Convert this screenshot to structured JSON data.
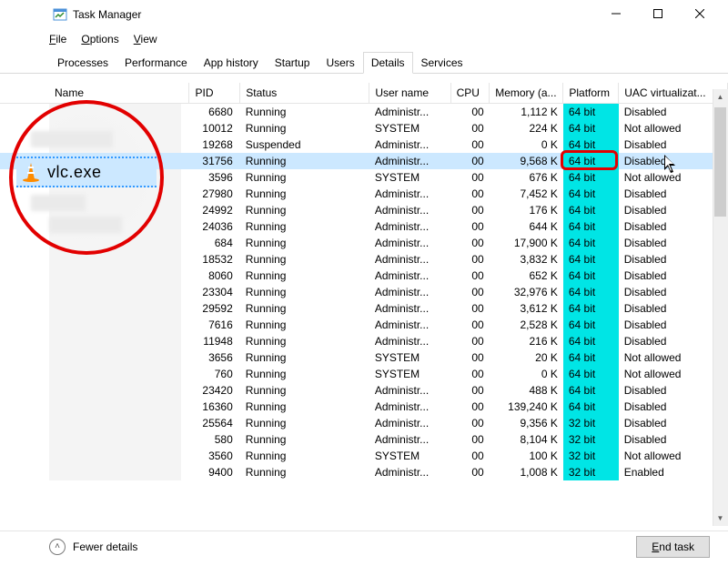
{
  "window": {
    "title": "Task Manager"
  },
  "menu": {
    "file": "File",
    "options": "Options",
    "view": "View"
  },
  "tabs": {
    "processes": "Processes",
    "performance": "Performance",
    "app_history": "App history",
    "startup": "Startup",
    "users": "Users",
    "details": "Details",
    "services": "Services",
    "active": "Details"
  },
  "columns": {
    "name": "Name",
    "pid": "PID",
    "status": "Status",
    "user": "User name",
    "cpu": "CPU",
    "memory": "Memory (a...",
    "platform": "Platform",
    "uac": "UAC virtualizat..."
  },
  "rows": [
    {
      "pid": "6680",
      "status": "Running",
      "user": "Administr...",
      "cpu": "00",
      "mem": "1,112 K",
      "plat": "64 bit",
      "uac": "Disabled"
    },
    {
      "pid": "10012",
      "status": "Running",
      "user": "SYSTEM",
      "cpu": "00",
      "mem": "224 K",
      "plat": "64 bit",
      "uac": "Not allowed"
    },
    {
      "pid": "19268",
      "status": "Suspended",
      "user": "Administr...",
      "cpu": "00",
      "mem": "0 K",
      "plat": "64 bit",
      "uac": "Disabled"
    },
    {
      "pid": "31756",
      "status": "Running",
      "user": "Administr...",
      "cpu": "00",
      "mem": "9,568 K",
      "plat": "64 bit",
      "uac": "Disabled",
      "selected": true,
      "name": "vlc.exe"
    },
    {
      "pid": "3596",
      "status": "Running",
      "user": "SYSTEM",
      "cpu": "00",
      "mem": "676 K",
      "plat": "64 bit",
      "uac": "Not allowed"
    },
    {
      "pid": "27980",
      "status": "Running",
      "user": "Administr...",
      "cpu": "00",
      "mem": "7,452 K",
      "plat": "64 bit",
      "uac": "Disabled"
    },
    {
      "pid": "24992",
      "status": "Running",
      "user": "Administr...",
      "cpu": "00",
      "mem": "176 K",
      "plat": "64 bit",
      "uac": "Disabled"
    },
    {
      "pid": "24036",
      "status": "Running",
      "user": "Administr...",
      "cpu": "00",
      "mem": "644 K",
      "plat": "64 bit",
      "uac": "Disabled"
    },
    {
      "pid": "684",
      "status": "Running",
      "user": "Administr...",
      "cpu": "00",
      "mem": "17,900 K",
      "plat": "64 bit",
      "uac": "Disabled"
    },
    {
      "pid": "18532",
      "status": "Running",
      "user": "Administr...",
      "cpu": "00",
      "mem": "3,832 K",
      "plat": "64 bit",
      "uac": "Disabled"
    },
    {
      "pid": "8060",
      "status": "Running",
      "user": "Administr...",
      "cpu": "00",
      "mem": "652 K",
      "plat": "64 bit",
      "uac": "Disabled"
    },
    {
      "pid": "23304",
      "status": "Running",
      "user": "Administr...",
      "cpu": "00",
      "mem": "32,976 K",
      "plat": "64 bit",
      "uac": "Disabled"
    },
    {
      "pid": "29592",
      "status": "Running",
      "user": "Administr...",
      "cpu": "00",
      "mem": "3,612 K",
      "plat": "64 bit",
      "uac": "Disabled"
    },
    {
      "pid": "7616",
      "status": "Running",
      "user": "Administr...",
      "cpu": "00",
      "mem": "2,528 K",
      "plat": "64 bit",
      "uac": "Disabled"
    },
    {
      "pid": "11948",
      "status": "Running",
      "user": "Administr...",
      "cpu": "00",
      "mem": "216 K",
      "plat": "64 bit",
      "uac": "Disabled"
    },
    {
      "pid": "3656",
      "status": "Running",
      "user": "SYSTEM",
      "cpu": "00",
      "mem": "20 K",
      "plat": "64 bit",
      "uac": "Not allowed"
    },
    {
      "pid": "760",
      "status": "Running",
      "user": "SYSTEM",
      "cpu": "00",
      "mem": "0 K",
      "plat": "64 bit",
      "uac": "Not allowed"
    },
    {
      "pid": "23420",
      "status": "Running",
      "user": "Administr...",
      "cpu": "00",
      "mem": "488 K",
      "plat": "64 bit",
      "uac": "Disabled"
    },
    {
      "pid": "16360",
      "status": "Running",
      "user": "Administr...",
      "cpu": "00",
      "mem": "139,240 K",
      "plat": "64 bit",
      "uac": "Disabled"
    },
    {
      "pid": "25564",
      "status": "Running",
      "user": "Administr...",
      "cpu": "00",
      "mem": "9,356 K",
      "plat": "32 bit",
      "uac": "Disabled"
    },
    {
      "pid": "580",
      "status": "Running",
      "user": "Administr...",
      "cpu": "00",
      "mem": "8,104 K",
      "plat": "32 bit",
      "uac": "Disabled"
    },
    {
      "pid": "3560",
      "status": "Running",
      "user": "SYSTEM",
      "cpu": "00",
      "mem": "100 K",
      "plat": "32 bit",
      "uac": "Not allowed"
    },
    {
      "pid": "9400",
      "status": "Running",
      "user": "Administr...",
      "cpu": "00",
      "mem": "1,008 K",
      "plat": "32 bit",
      "uac": "Enabled"
    }
  ],
  "footer": {
    "fewer": "Fewer details",
    "end_task": "End task"
  },
  "callout": {
    "label": "vlc.exe"
  },
  "colors": {
    "platform_highlight": "#00e5e5",
    "selection": "#cce8ff",
    "callout_border": "#e20000"
  }
}
